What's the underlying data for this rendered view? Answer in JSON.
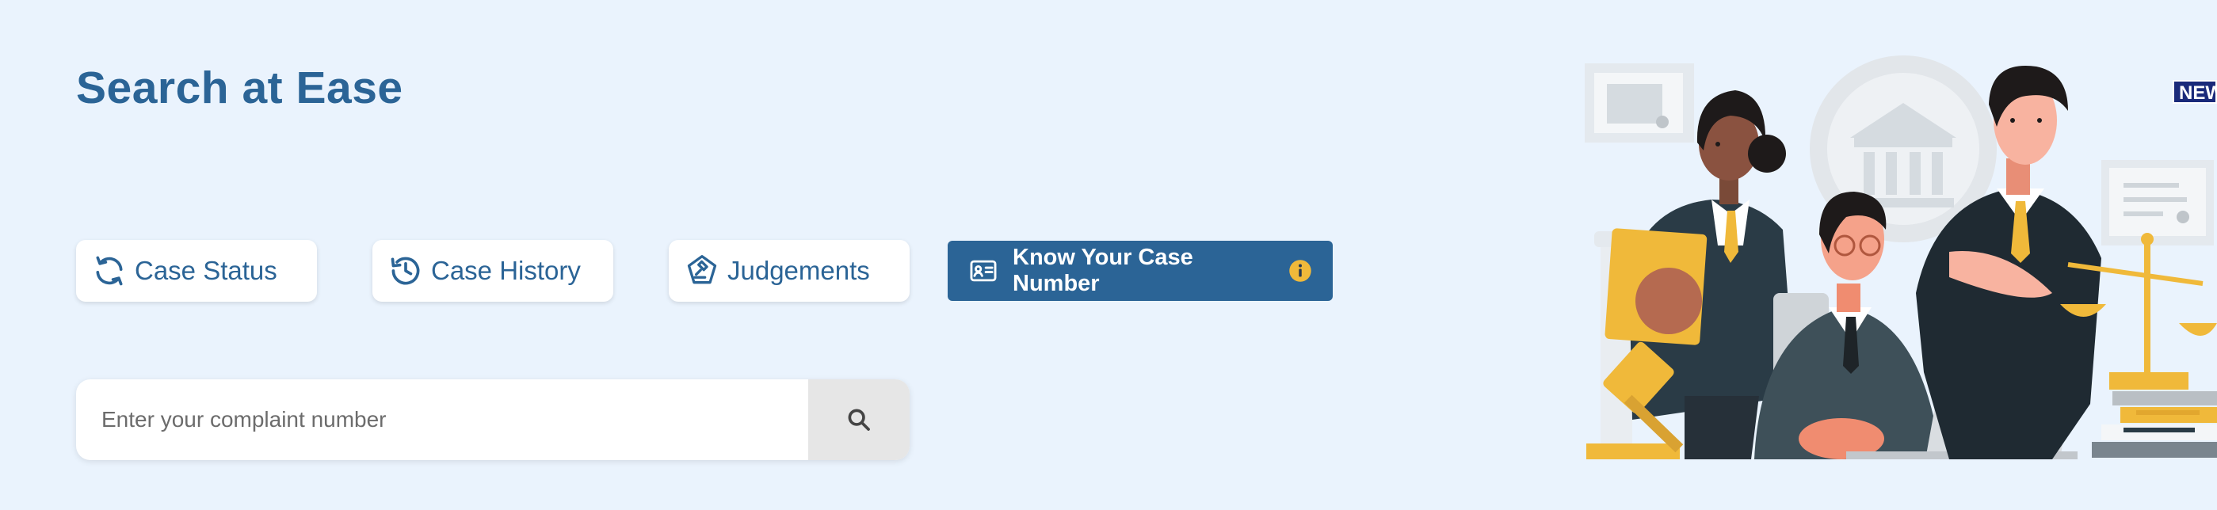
{
  "header": {
    "title": "Search at Ease"
  },
  "quick_links": [
    {
      "label": "Case Status",
      "icon": "refresh-icon"
    },
    {
      "label": "Case History",
      "icon": "history-icon"
    },
    {
      "label": "Judgements",
      "icon": "gavel-icon"
    }
  ],
  "know_case_button": {
    "label": "Know Your Case Number",
    "icon": "id-card-icon",
    "info_icon": "info-icon"
  },
  "search": {
    "placeholder": "Enter your complaint number",
    "value": "",
    "button_icon": "search-icon"
  },
  "badge": {
    "label": "NEW"
  },
  "illustration": {
    "name": "legal-team-illustration"
  },
  "colors": {
    "background": "#eaf3fd",
    "primary": "#2b6496",
    "accent": "#f0b93a",
    "badge": "#1a2a7a"
  }
}
